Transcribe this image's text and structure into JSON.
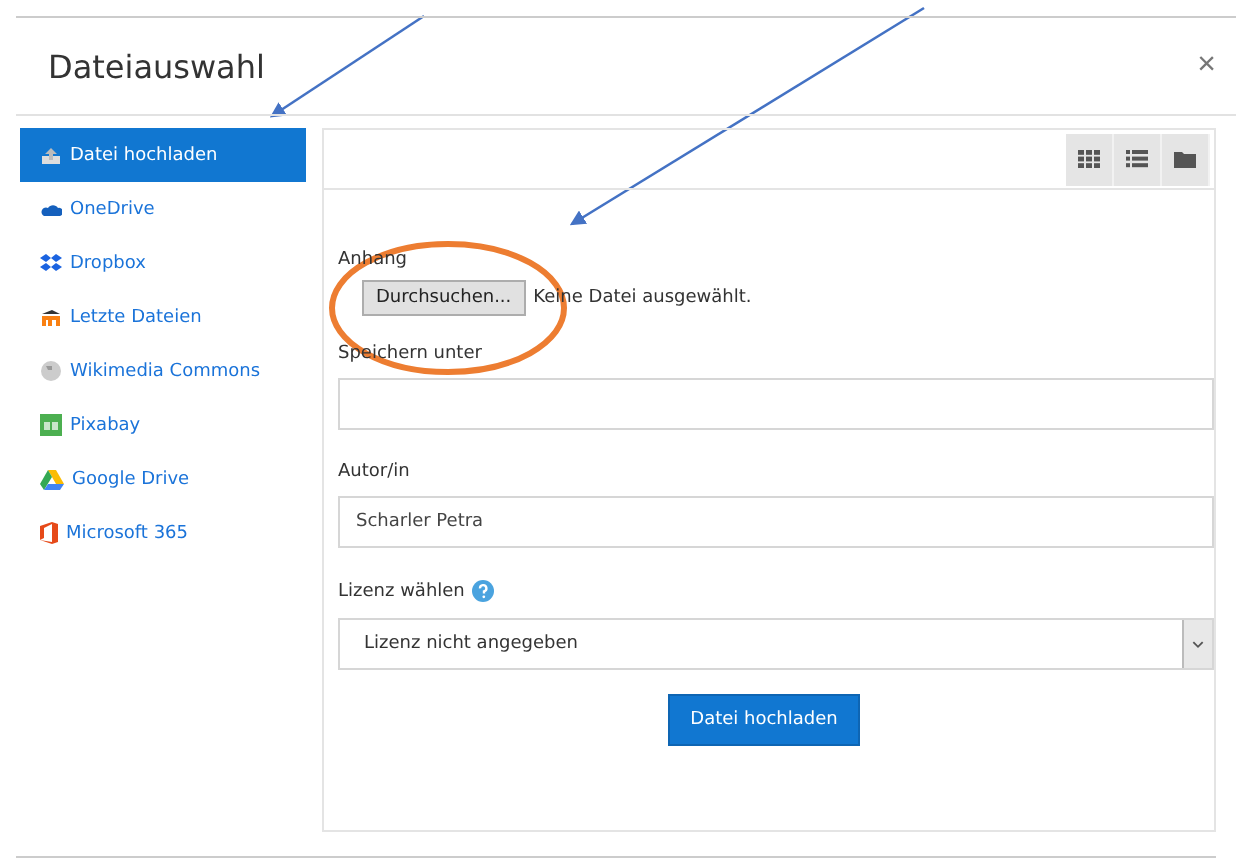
{
  "dialog": {
    "title": "Dateiauswahl",
    "close": "×"
  },
  "sidebar": {
    "items": [
      {
        "label": "Datei hochladen",
        "selected": true
      },
      {
        "label": "OneDrive",
        "selected": false
      },
      {
        "label": "Dropbox",
        "selected": false
      },
      {
        "label": "Letzte Dateien",
        "selected": false
      },
      {
        "label": "Wikimedia Commons",
        "selected": false
      },
      {
        "label": "Pixabay",
        "selected": false
      },
      {
        "label": "Google Drive",
        "selected": false
      },
      {
        "label": "Microsoft 365",
        "selected": false
      }
    ]
  },
  "form": {
    "attachment_label": "Anhang",
    "browse_button": "Durchsuchen...",
    "no_file": "Keine Datei ausgewählt.",
    "save_as_label": "Speichern unter",
    "author_label": "Autor/in",
    "author_value": "Scharler Petra",
    "license_label": "Lizenz wählen",
    "license_value": "Lizenz nicht angegeben",
    "submit": "Datei hochladen"
  },
  "annotations": [
    {
      "kind": "arrow"
    },
    {
      "kind": "arrow"
    },
    {
      "kind": "ellipse"
    }
  ]
}
